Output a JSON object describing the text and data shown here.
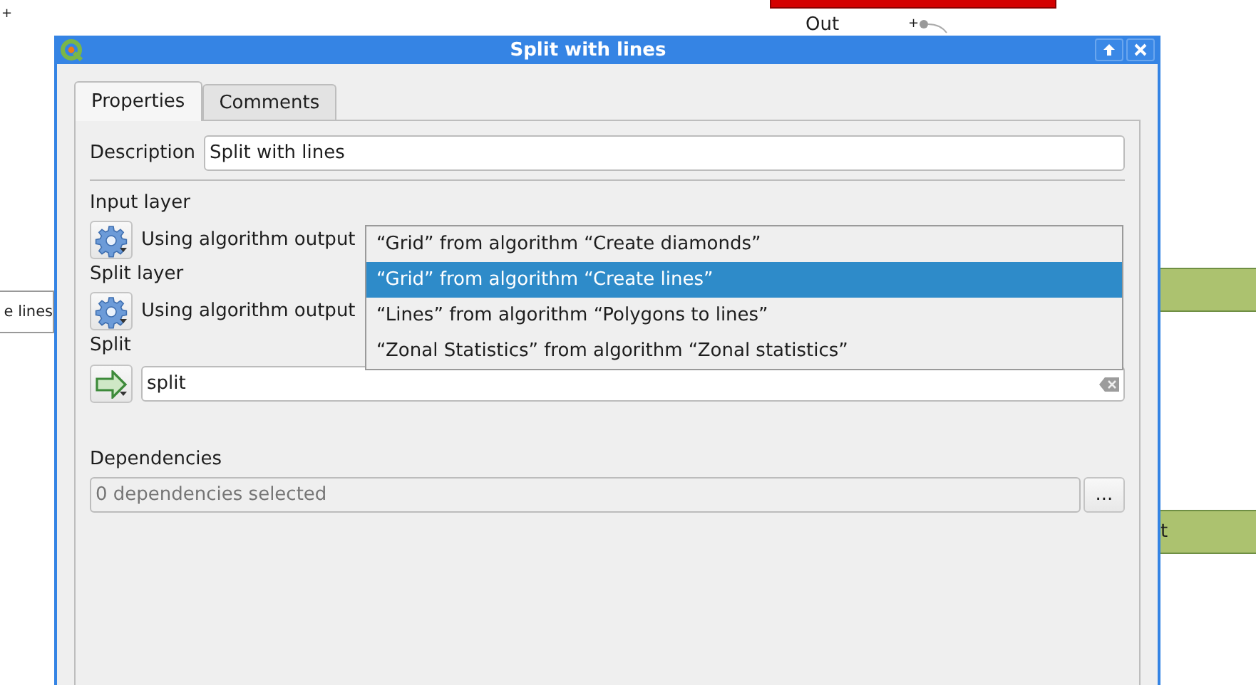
{
  "canvas": {
    "corner_mark": "+",
    "output_port": {
      "label": "Out",
      "plus": "+"
    },
    "nodes": [
      {
        "kind": "red"
      },
      {
        "kind": "plain",
        "label": "e lines"
      },
      {
        "kind": "green"
      },
      {
        "kind": "green",
        "label": "t"
      }
    ]
  },
  "window": {
    "title": "Split with lines"
  },
  "tabs": [
    {
      "label": "Properties",
      "selected": true
    },
    {
      "label": "Comments",
      "selected": false
    }
  ],
  "description": {
    "label": "Description",
    "value": "Split with lines"
  },
  "parameters": [
    {
      "kind": "layer",
      "label": "Input layer",
      "value": "Using algorithm output"
    },
    {
      "kind": "layer",
      "label": "Split layer",
      "value": "Using algorithm output"
    },
    {
      "kind": "output",
      "label": "Split",
      "value": "split"
    }
  ],
  "dropdown": {
    "items": [
      {
        "label": "“Grid” from algorithm “Create diamonds”",
        "selected": false
      },
      {
        "label": "“Grid” from algorithm “Create lines”",
        "selected": true
      },
      {
        "label": "“Lines” from algorithm “Polygons to lines”",
        "selected": false
      },
      {
        "label": "“Zonal Statistics” from algorithm “Zonal statistics”",
        "selected": false
      }
    ]
  },
  "dependencies": {
    "label": "Dependencies",
    "placeholder": "0 dependencies selected",
    "disabled": true,
    "button": "..."
  }
}
